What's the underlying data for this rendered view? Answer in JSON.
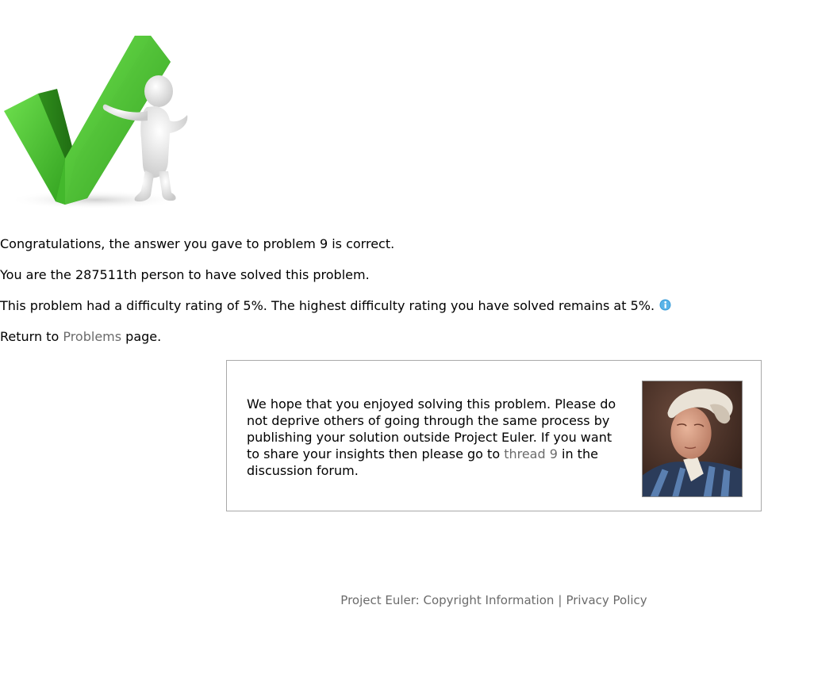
{
  "hero": {
    "image_desc": "green-checkmark-with-3d-figure"
  },
  "result": {
    "line1": "Congratulations, the answer you gave to problem 9 is correct.",
    "line2": "You are the 287511th person to have solved this problem.",
    "line3": "This problem had a difficulty rating of 5%. The highest difficulty rating you have solved remains at 5%.",
    "info_icon": "info-icon",
    "return_prefix": "Return to ",
    "return_link": "Problems",
    "return_suffix": " page."
  },
  "notice": {
    "text_before": "We hope that you enjoyed solving this problem. Please do not deprive others of going through the same process by publishing your solution outside Project Euler. If you want to share your insights then please go to ",
    "thread_link": "thread 9",
    "text_after": " in the discussion forum.",
    "portrait": "euler-portrait"
  },
  "footer": {
    "brand": "Project Euler: ",
    "copyright_link": "Copyright Information",
    "separator": "|",
    "privacy_link": "Privacy Policy"
  },
  "colors": {
    "link": "#6b6b6b",
    "check_green": "#4cc234",
    "info_blue": "#3a9bd6"
  }
}
